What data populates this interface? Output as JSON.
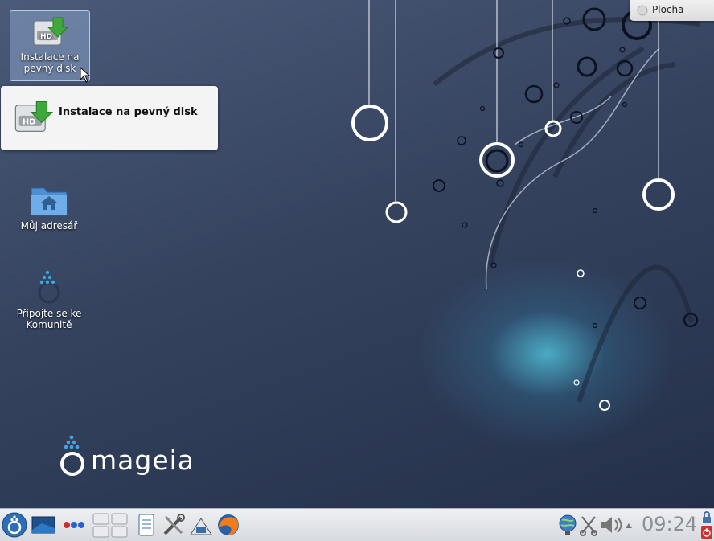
{
  "desktop": {
    "icons": [
      {
        "label_line1": "Instalace na",
        "label_line2": "pevný disk",
        "icon": "harddisk-install-icon"
      },
      {
        "label_line1": "Můj adresář",
        "icon": "home-folder-icon"
      },
      {
        "label_line1": "Připojte se ke",
        "label_line2": "Komunitě",
        "icon": "community-icon"
      }
    ],
    "tooltip": {
      "title": "Instalace na pevný disk",
      "icon": "harddisk-install-icon"
    },
    "cashew": {
      "label": "Plocha"
    },
    "branding": {
      "logo_text": "mageia"
    }
  },
  "taskbar": {
    "launchers": [
      "mageia-menu-icon",
      "desktop-icon",
      "activities-icon",
      "pager-icon",
      "notes-icon",
      "tools-icon",
      "installer-icon",
      "firefox-icon"
    ],
    "tray": [
      "network-icon",
      "clipboard-icon",
      "volume-icon",
      "expand-tray-icon"
    ],
    "clock": "09:24",
    "lock_icon": "lock-icon",
    "power_icon": "power-icon"
  }
}
